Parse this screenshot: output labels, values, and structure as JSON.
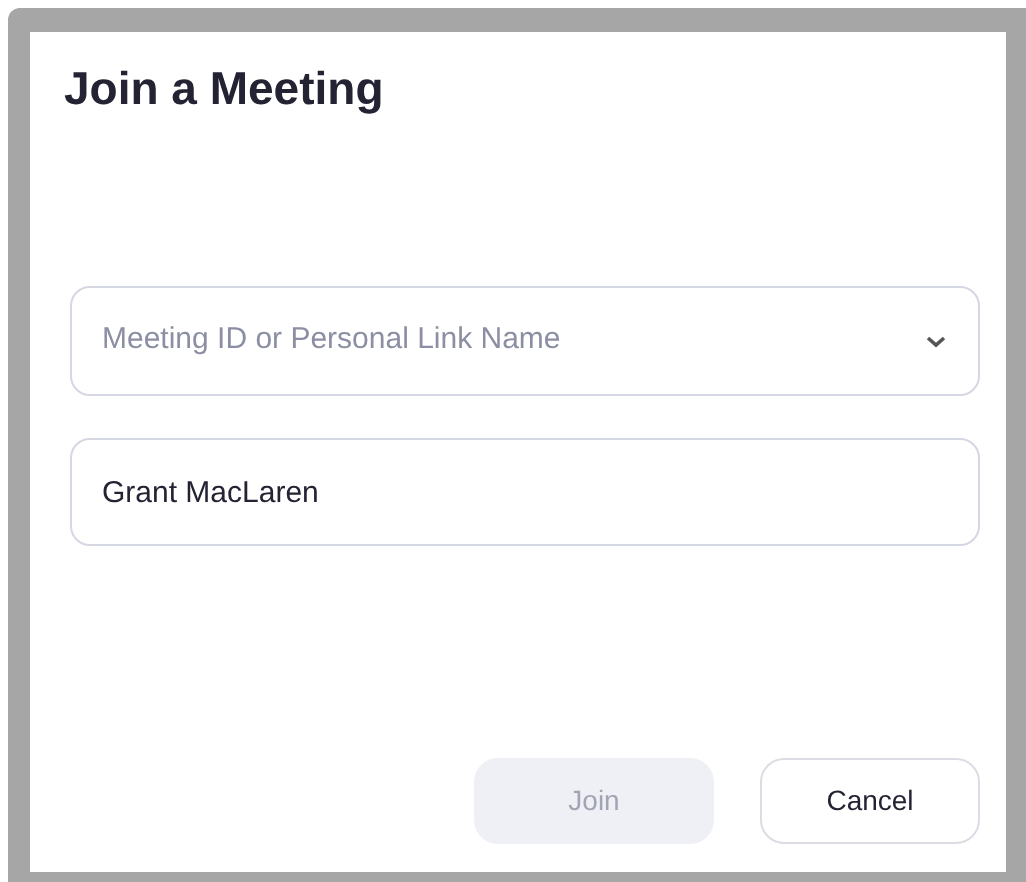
{
  "dialog": {
    "title": "Join a Meeting"
  },
  "meeting_field": {
    "placeholder": "Meeting ID or Personal Link Name"
  },
  "name_field": {
    "value": "Grant MacLaren"
  },
  "buttons": [
    {
      "label": "Join",
      "disabled": true
    },
    {
      "label": "Cancel",
      "disabled": false
    }
  ]
}
